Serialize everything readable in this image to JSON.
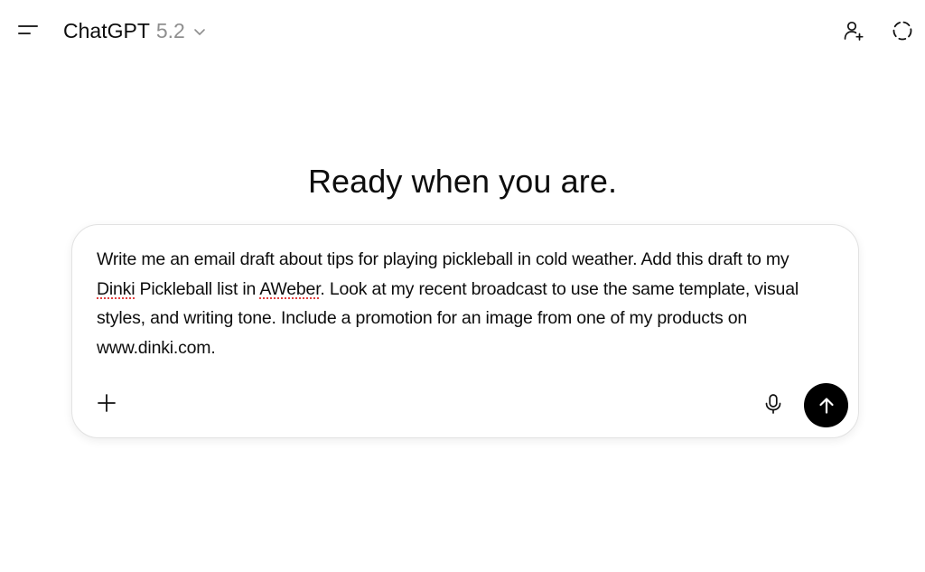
{
  "header": {
    "model_name": "ChatGPT",
    "model_version": "5.2",
    "icons": [
      "menu-icon",
      "chevron-down-icon",
      "add-person-icon",
      "temporary-chat-icon"
    ]
  },
  "main": {
    "title": "Ready when you are."
  },
  "composer": {
    "text_before_dinki": "Write me an email draft about tips for playing pickleball in cold weather. Add this draft to my ",
    "word_dinki": "Dinki",
    "text_middle": " Pickleball list in ",
    "word_aweber": "AWeber",
    "text_after": ". Look at my recent broadcast to use the same template, visual styles, and writing tone. Include a promotion for an image from one of my products on www.dinki.com.",
    "icons": [
      "plus-icon",
      "microphone-icon",
      "arrow-up-icon"
    ]
  },
  "colors": {
    "text": "#0d0d0d",
    "muted": "#8f8f8f",
    "send_button": "#000000",
    "spellcheck": "#e03b3b",
    "composer_border": "#e2e2e2"
  }
}
